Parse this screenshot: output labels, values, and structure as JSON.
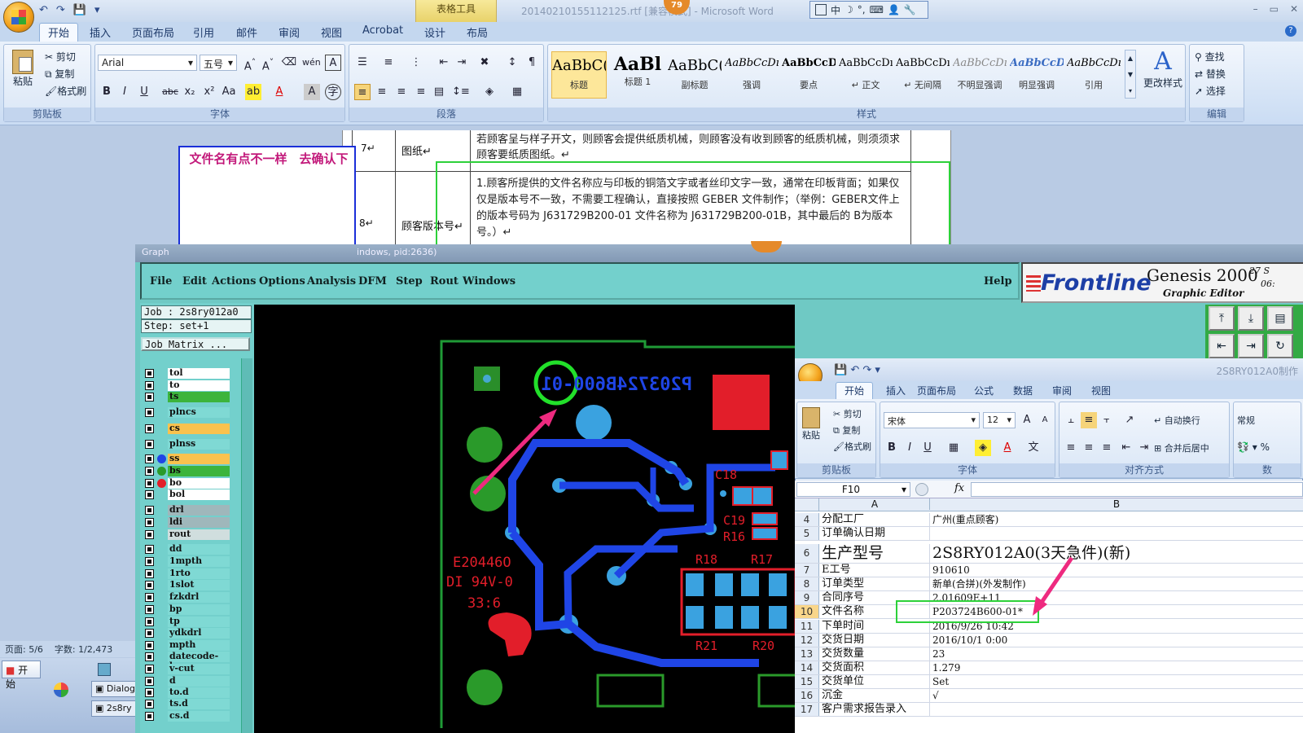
{
  "word": {
    "quick_access": [
      "↶",
      "↷",
      "💾",
      "▾"
    ],
    "context_tab": "表格工具",
    "document_title": "20140210155112125.rtf [兼容模式] - Microsoft Word",
    "notification_count": "79",
    "ime_bar": [
      "中",
      "☽",
      "°,",
      "⌨",
      "👤",
      "🔧"
    ],
    "window_controls": [
      "–",
      "▭",
      "✕"
    ],
    "tabs": [
      "开始",
      "插入",
      "页面布局",
      "引用",
      "邮件",
      "审阅",
      "视图",
      "Acrobat",
      "设计",
      "布局"
    ],
    "clipboard": {
      "paste": "粘贴",
      "cut": "剪切",
      "copy": "复制",
      "format_painter": "格式刷",
      "group": "剪贴板"
    },
    "font": {
      "name": "Arial",
      "size": "五号",
      "group": "字体"
    },
    "paragraph": {
      "group": "段落"
    },
    "styles": {
      "items": [
        {
          "preview": "AaBbC(",
          "label": "标题"
        },
        {
          "preview": "AaBl",
          "label": "标题 1"
        },
        {
          "preview": "AaBbC(",
          "label": "副标题"
        },
        {
          "preview": "AaBbCcDı",
          "label": "强调"
        },
        {
          "preview": "AaBbCcD",
          "label": "要点"
        },
        {
          "preview": "AaBbCcDı",
          "label": "↵ 正文"
        },
        {
          "preview": "AaBbCcDı",
          "label": "↵ 无间隔"
        },
        {
          "preview": "AaBbCcDı",
          "label": "不明显强调"
        },
        {
          "preview": "AaBbCcDı",
          "label": "明显强调"
        },
        {
          "preview": "AaBbCcDı",
          "label": "引用"
        }
      ],
      "change_styles": "更改样式",
      "group": "样式"
    },
    "editing": {
      "find": "查找",
      "replace": "替换",
      "select": "选择",
      "group": "编辑"
    },
    "table": {
      "row7": {
        "num": "7↵",
        "label": "图纸↵",
        "text": "若顾客呈与样子开文，则顾客会提供纸质机械，则顾客没有收到顾客的纸质机械，则须须求顾客要纸质图纸。↵"
      },
      "row8": {
        "num": "8↵",
        "label": "顾客版本号↵",
        "text": "1.顾客所提供的文件名称应与印板的铜箔文字或者丝印文字一致，通常在印板背面；如果仅仅是版本号不一致，不需要工程确认，直接按照 GEBER 文件制作；（举例：GEBER文件上的版本号码为 J631729B200-01 文件名称为 J631729B200-01B，其中最后的 B为版本号。）↵"
      }
    },
    "note": "文件名有点不一样　去确认下",
    "status": {
      "page": "页面: 5/6",
      "words": "字数: 1/2,473"
    }
  },
  "taskbar": {
    "start": "开始",
    "items": [
      "Dialog",
      "2s8ry"
    ]
  },
  "genesis": {
    "title_left": "Graph",
    "title_right": "indows, pid:2636)",
    "menu": [
      "File",
      "Edit",
      "Actions",
      "Options",
      "Analysis",
      "DFM",
      "Step",
      "Rout",
      "Windows"
    ],
    "help": "Help",
    "brand": "Frontline",
    "product": "Genesis 2000",
    "product_sub": "Graphic Editor",
    "version": "27  S",
    "time": "06:",
    "job": "Job : 2s8ry012a0",
    "step": "Step: set+1",
    "job_matrix": "Job Matrix ...",
    "layers": [
      {
        "name": "tol",
        "color": "#ffffff"
      },
      {
        "name": "to",
        "color": "#ffffff"
      },
      {
        "name": "ts",
        "color": "#3cb43c"
      },
      {
        "name": "plncs",
        "color": "#7fd9d4"
      },
      {
        "name": "cs",
        "color": "#f9c24e"
      },
      {
        "name": "plnss",
        "color": "#7fd9d4"
      },
      {
        "name": "ss",
        "color": "#f9c24e"
      },
      {
        "name": "bs",
        "color": "#3cb43c"
      },
      {
        "name": "bo",
        "color": "#ffffff"
      },
      {
        "name": "bol",
        "color": "#ffffff"
      },
      {
        "name": "drl",
        "color": "#9fb7bb"
      },
      {
        "name": "ldi",
        "color": "#9fb7bb"
      },
      {
        "name": "rout",
        "color": "#d0dede"
      },
      {
        "name": "dd",
        "color": "#7fd9d4"
      },
      {
        "name": "1mpth",
        "color": "#7fd9d4"
      },
      {
        "name": "1rto",
        "color": "#7fd9d4"
      },
      {
        "name": "1slot",
        "color": "#7fd9d4"
      },
      {
        "name": "fzkdrl",
        "color": "#7fd9d4"
      },
      {
        "name": "bp",
        "color": "#7fd9d4"
      },
      {
        "name": "tp",
        "color": "#7fd9d4"
      },
      {
        "name": "ydkdrl",
        "color": "#7fd9d4"
      },
      {
        "name": "mpth",
        "color": "#7fd9d4"
      },
      {
        "name": "datecode-bo",
        "color": "#7fd9d4"
      },
      {
        "name": "v-cut",
        "color": "#7fd9d4"
      },
      {
        "name": "d",
        "color": "#7fd9d4"
      },
      {
        "name": "to.d",
        "color": "#7fd9d4"
      },
      {
        "name": "ts.d",
        "color": "#7fd9d4"
      },
      {
        "name": "cs.d",
        "color": "#7fd9d4"
      }
    ],
    "pcb_text": {
      "part_number": "P203724B600-01",
      "date_code": "E20446O",
      "rating": "DI 94V-0",
      "week": "33:6",
      "refs": [
        "C18",
        "C19",
        "R16",
        "R18",
        "R17",
        "R21",
        "R20"
      ]
    }
  },
  "excel": {
    "title": "2S8RY012A0制作",
    "tabs": [
      "开始",
      "插入",
      "页面布局",
      "公式",
      "数据",
      "审阅",
      "视图"
    ],
    "clipboard": {
      "cut": "剪切",
      "copy": "复制",
      "paste": "粘贴",
      "format_painter": "格式刷",
      "group": "剪贴板"
    },
    "font": {
      "name": "宋体",
      "size": "12",
      "group": "字体"
    },
    "align": {
      "wrap": "自动换行",
      "merge": "合并后居中",
      "group": "对齐方式"
    },
    "number": {
      "format": "常规",
      "group": "数"
    },
    "name_box": "F10",
    "col_headers": [
      "A",
      "B"
    ],
    "rows": [
      {
        "n": "4",
        "a": "分配工厂",
        "b": "广州(重点顾客)"
      },
      {
        "n": "5",
        "a": "订单确认日期",
        "b": ""
      },
      {
        "n": "6",
        "a": "生产型号",
        "b": "2S8RY012A0(3天急件)(新)"
      },
      {
        "n": "7",
        "a": "E工号",
        "b": "910610"
      },
      {
        "n": "8",
        "a": "订单类型",
        "b": "新单(合拼)(外发制作)"
      },
      {
        "n": "9",
        "a": "合同序号",
        "b": "2.01609E+11"
      },
      {
        "n": "10",
        "a": "文件名称",
        "b": "P203724B600-01*"
      },
      {
        "n": "11",
        "a": "下单时间",
        "b": "2016/9/26 10:42"
      },
      {
        "n": "12",
        "a": "交货日期",
        "b": "2016/10/1 0:00"
      },
      {
        "n": "13",
        "a": "交货数量",
        "b": "23"
      },
      {
        "n": "14",
        "a": "交货面积",
        "b": "1.279"
      },
      {
        "n": "15",
        "a": "交货单位",
        "b": "Set"
      },
      {
        "n": "16",
        "a": "沉金",
        "b": "√"
      },
      {
        "n": "17",
        "a": "客户需求报告录入",
        "b": ""
      }
    ]
  }
}
